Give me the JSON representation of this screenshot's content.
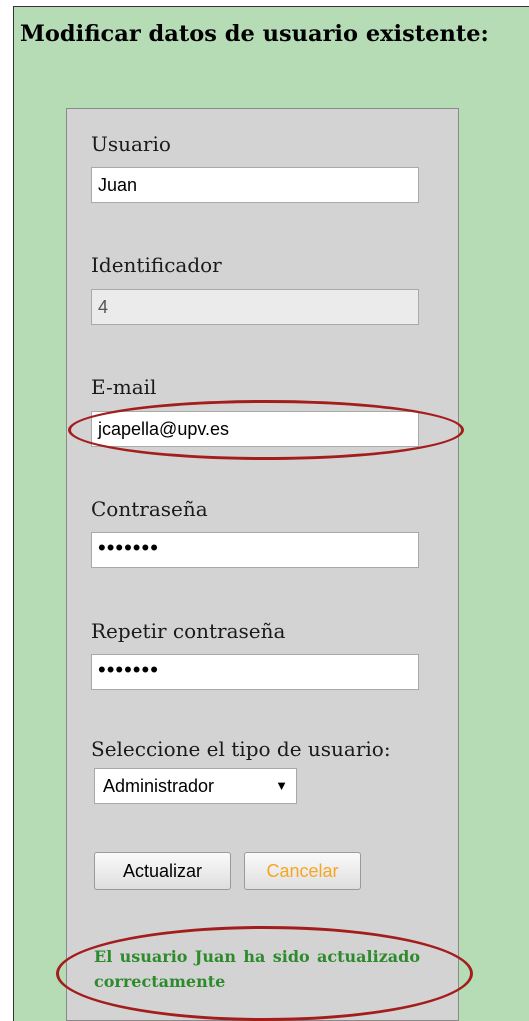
{
  "page": {
    "title": "Modificar datos de usuario existente:"
  },
  "form": {
    "user": {
      "label": "Usuario",
      "value": "Juan"
    },
    "id": {
      "label": "Identificador",
      "value": "4"
    },
    "email": {
      "label": "E-mail",
      "value": "jcapella@upv.es"
    },
    "password": {
      "label": "Contraseña",
      "value": "•••••••"
    },
    "repeat_password": {
      "label": "Repetir contraseña",
      "value": "•••••••"
    },
    "user_type": {
      "label": "Seleccione el tipo de usuario:",
      "selected": "Administrador",
      "arrow": "▼"
    },
    "update_label": "Actualizar",
    "cancel_label": "Cancelar",
    "message": "El usuario Juan ha sido actualizado correctamente"
  },
  "colors": {
    "background": "#b6dcb6",
    "panel": "#d3d3d3",
    "message": "#2d8a2d",
    "cancel_text": "#f5a623",
    "highlight_ring": "#a31d1d"
  }
}
